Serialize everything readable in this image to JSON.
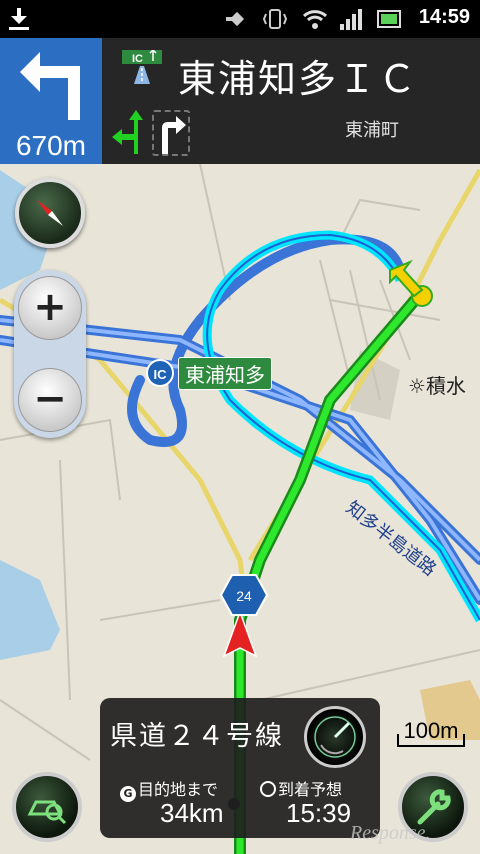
{
  "status_bar": {
    "time": "14:59",
    "icons": [
      "download-icon",
      "gps-icon",
      "vibrate-icon",
      "wifi-icon",
      "signal-icon",
      "battery-icon"
    ]
  },
  "guidance": {
    "turn_direction": "turn-left",
    "turn_distance": "670m",
    "next_point_name": "東浦知多ＩＣ",
    "badge_text": "IC",
    "town_name": "東浦町",
    "lanes": [
      "left-straight-lane",
      "right-turn-lane"
    ]
  },
  "map": {
    "interchange_badge": "IC",
    "interchange_name": "東浦知多",
    "poi_name": "積水",
    "expressway_name": "知多半島道路",
    "road_number": "24",
    "scale_label": "100m",
    "colors": {
      "route": "#2ee82e",
      "expressway": "#1e90ff",
      "highlight": "#00e5ff",
      "land": "#e8e4d8",
      "water": "#a9cfe8"
    }
  },
  "route_panel": {
    "road_name": "県道２４号線",
    "destination_label": "目的地まで",
    "destination_icon": "G",
    "destination_distance": "34km",
    "eta_label": "到着予想",
    "eta_time": "15:39"
  },
  "watermark": "Response."
}
